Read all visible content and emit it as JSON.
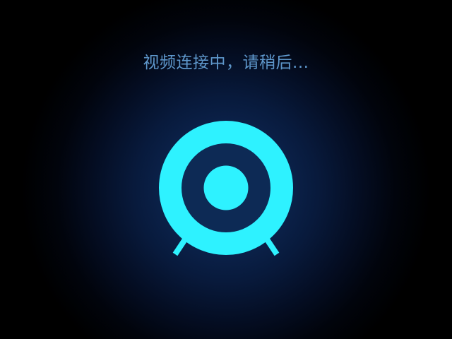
{
  "status": {
    "message": "视频连接中，请稍后..."
  },
  "icon": {
    "name": "camera-icon",
    "color": "#2ef2ff"
  },
  "colors": {
    "background": "#000000",
    "glow": "#0f2c58",
    "text": "#5e97cb"
  }
}
